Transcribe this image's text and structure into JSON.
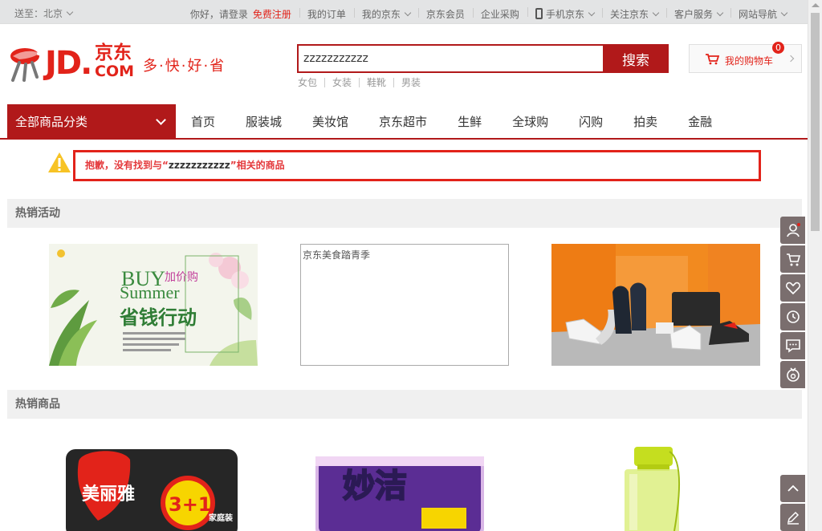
{
  "topbar": {
    "location": "送至：北京",
    "hello": "你好，请登录",
    "register": "免费注册",
    "items": [
      "我的订单",
      "我的京东",
      "京东会员",
      "企业采购",
      "手机京东",
      "关注京东",
      "客户服务",
      "网站导航"
    ]
  },
  "logo": {
    "jd": "JD.",
    "cn": "京东",
    "com": "COM",
    "slogan": "多·快·好·省"
  },
  "search": {
    "value": "zzzzzzzzzzz",
    "button": "搜索",
    "hotwords": [
      "女包",
      "女装",
      "鞋靴",
      "男装"
    ]
  },
  "cart": {
    "label": "我的购物车",
    "count": "0"
  },
  "nav": {
    "all_categories": "全部商品分类",
    "links": [
      "首页",
      "服装城",
      "美妆馆",
      "京东超市",
      "生鲜",
      "全球购",
      "闪购",
      "拍卖",
      "金融"
    ]
  },
  "notice": {
    "prefix": "抱歉，没有找到与“",
    "keyword": "zzzzzzzzzzz",
    "suffix": "”相关的商品"
  },
  "hot_activities": {
    "title": "热销活动",
    "promo1": {
      "buy": "BUY",
      "jiajia": "加价购",
      "summer": "Summer",
      "headline": "省钱行动"
    },
    "promo2_alt": "京东美食踏青季"
  },
  "hot_products": {
    "title": "热销商品",
    "p1_brand": "美丽雅",
    "p1_badge": "3+1",
    "p1_sub": "家庭装",
    "p2_brand": "妙洁"
  },
  "colors": {
    "jd_red": "#e2231a",
    "nav_red": "#b1191a",
    "toolbar": "#7a6e6e"
  }
}
